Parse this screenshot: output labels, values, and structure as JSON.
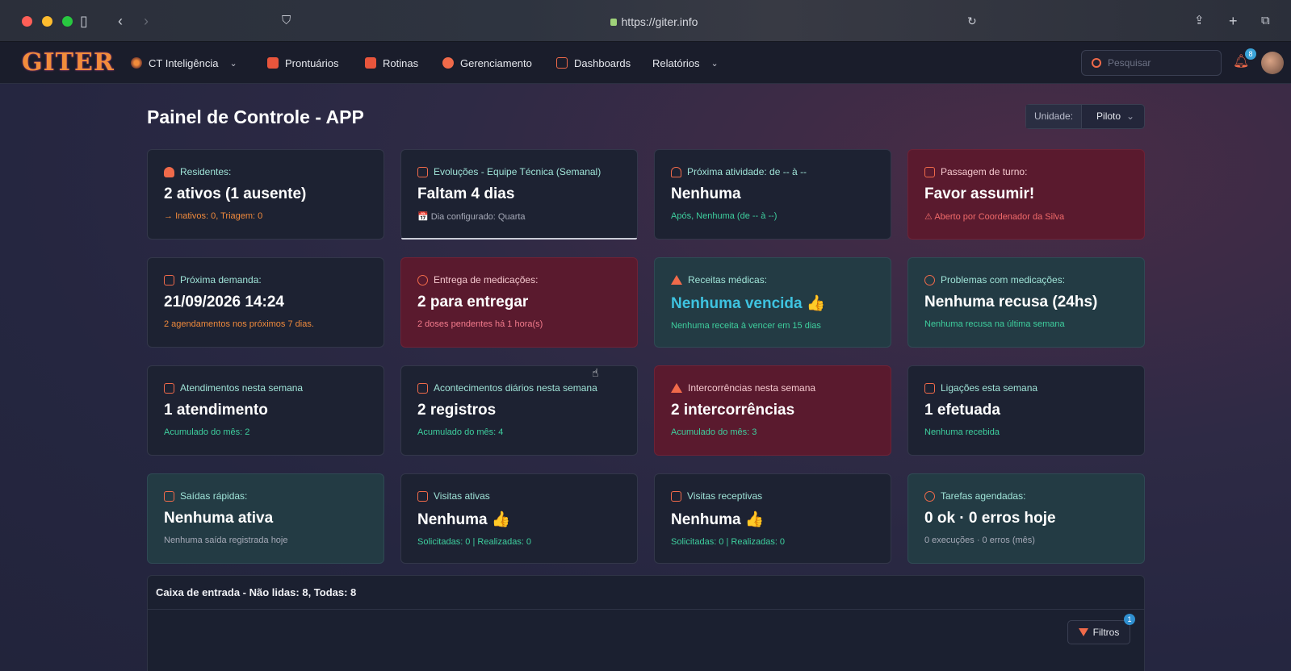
{
  "browser": {
    "url": "https://giter.info"
  },
  "nav": {
    "logo": "GITER",
    "items": [
      {
        "label": "CT Inteligência"
      },
      {
        "label": "Prontuários"
      },
      {
        "label": "Rotinas"
      },
      {
        "label": "Gerenciamento"
      },
      {
        "label": "Dashboards"
      },
      {
        "label": "Relatórios"
      }
    ],
    "search_placeholder": "Pesquisar",
    "notifications_count": "8"
  },
  "page": {
    "title": "Painel de Controle - APP",
    "unit_label": "Unidade:",
    "unit_value": "Piloto"
  },
  "cards": [
    {
      "title": "Residentes:",
      "value": "2 ativos (1 ausente)",
      "sub": "Inativos: 0, Triagem: 0"
    },
    {
      "title": "Evoluções - Equipe Técnica (Semanal)",
      "value": "Faltam 4 dias",
      "sub": "📅 Dia configurado: Quarta"
    },
    {
      "title": "Próxima atividade: de -- à --",
      "value": "Nenhuma",
      "sub": "Após, Nenhuma (de -- à --)"
    },
    {
      "title": "Passagem de turno:",
      "value": "Favor assumir!",
      "sub": "Aberto por Coordenador da Silva"
    },
    {
      "title": "Próxima demanda:",
      "value": "21/09/2026 14:24",
      "sub": "2 agendamentos nos próximos 7 dias."
    },
    {
      "title": "Entrega de medicações:",
      "value": "2 para entregar",
      "sub": "2 doses pendentes há 1 hora(s)"
    },
    {
      "title": "Receitas médicas:",
      "value": "Nenhuma vencida 👍",
      "sub": "Nenhuma receita à vencer em 15 dias"
    },
    {
      "title": "Problemas com medicações:",
      "value": "Nenhuma recusa (24hs)",
      "sub": "Nenhuma recusa na última semana"
    },
    {
      "title": "Atendimentos nesta semana",
      "value": "1 atendimento",
      "sub": "Acumulado do mês: 2"
    },
    {
      "title": "Acontecimentos diários nesta semana",
      "value": "2 registros",
      "sub": "Acumulado do mês: 4"
    },
    {
      "title": "Intercorrências nesta semana",
      "value": "2 intercorrências",
      "sub": "Acumulado do mês: 3"
    },
    {
      "title": "Ligações esta semana",
      "value": "1 efetuada",
      "sub": "Nenhuma recebida"
    },
    {
      "title": "Saídas rápidas:",
      "value": "Nenhuma ativa",
      "sub": "Nenhuma saída registrada hoje"
    },
    {
      "title": "Visitas ativas",
      "value": "Nenhuma 👍",
      "sub": "Solicitadas: 0 | Realizadas: 0"
    },
    {
      "title": "Visitas receptivas",
      "value": "Nenhuma 👍",
      "sub": "Solicitadas: 0 | Realizadas: 0"
    },
    {
      "title": "Tarefas agendadas:",
      "value": "0 ok · 0 erros hoje",
      "sub": "0 execuções · 0 erros (mês)"
    }
  ],
  "inbox": {
    "title": "Caixa de entrada - Não lidas: 8, Todas: 8",
    "filters_label": "Filtros",
    "filters_count": "1"
  }
}
